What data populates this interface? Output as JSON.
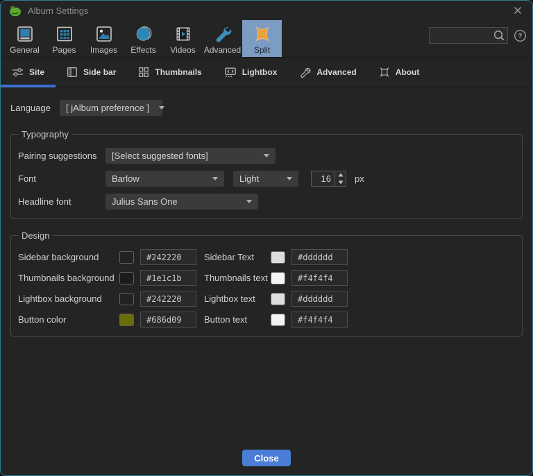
{
  "titlebar": {
    "title": "Album Settings"
  },
  "toolbar": {
    "items": [
      {
        "label": "General"
      },
      {
        "label": "Pages"
      },
      {
        "label": "Images"
      },
      {
        "label": "Effects"
      },
      {
        "label": "Videos"
      },
      {
        "label": "Advanced"
      },
      {
        "label": "Split",
        "selected": true
      }
    ],
    "search_value": ""
  },
  "tabs": {
    "items": [
      {
        "label": "Site",
        "selected": true
      },
      {
        "label": "Side bar"
      },
      {
        "label": "Thumbnails"
      },
      {
        "label": "Lightbox"
      },
      {
        "label": "Advanced"
      },
      {
        "label": "About"
      }
    ]
  },
  "content": {
    "language_label": "Language",
    "language_value": "[ jAlbum preference ]",
    "typography": {
      "legend": "Typography",
      "pairing_label": "Pairing suggestions",
      "pairing_value": "[Select suggested fonts]",
      "font_label": "Font",
      "font_family": "Barlow",
      "font_weight": "Light",
      "font_size": "16",
      "font_unit": "px",
      "headline_label": "Headline font",
      "headline_value": "Julius Sans One"
    },
    "design": {
      "legend": "Design",
      "rows": [
        {
          "label_a": "Sidebar background",
          "swatch_a": "#242220",
          "hex_a": "#242220",
          "label_b": "Sidebar Text",
          "swatch_b": "#dddddd",
          "hex_b": "#dddddd"
        },
        {
          "label_a": "Thumbnails background",
          "swatch_a": "#1e1c1b",
          "hex_a": "#1e1c1b",
          "label_b": "Thumbnails text",
          "swatch_b": "#f4f4f4",
          "hex_b": "#f4f4f4"
        },
        {
          "label_a": "Lightbox background",
          "swatch_a": "#242220",
          "hex_a": "#242220",
          "label_b": "Lightbox text",
          "swatch_b": "#dddddd",
          "hex_b": "#dddddd"
        },
        {
          "label_a": "Button color",
          "swatch_a": "#686d09",
          "hex_a": "#686d09",
          "label_b": "Button text",
          "swatch_b": "#f4f4f4",
          "hex_b": "#f4f4f4"
        }
      ]
    }
  },
  "footer": {
    "close_label": "Close"
  },
  "colors": {
    "accent_underline": "#3a6fd1",
    "close_button": "#4a7dd6",
    "split_selected_bg": "#7d9cc4",
    "window_border": "#2c7b90"
  }
}
